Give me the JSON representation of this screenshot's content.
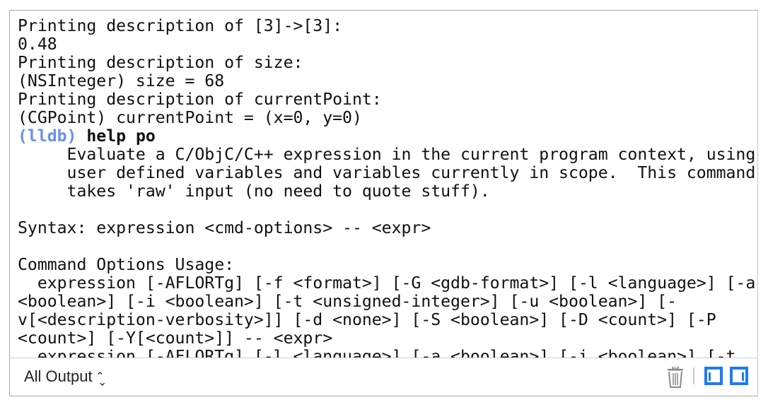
{
  "console": {
    "lines": [
      "Printing description of [3]->[3]:",
      "0.48",
      "Printing description of size:",
      "(NSInteger) size = 68",
      "Printing description of currentPoint:",
      "(CGPoint) currentPoint = (x=0, y=0)",
      "",
      "     Evaluate a C/ObjC/C++ expression in the current program context, using",
      "     user defined variables and variables currently in scope.  This command",
      "     takes 'raw' input (no need to quote stuff).",
      "",
      "Syntax: expression <cmd-options> -- <expr>",
      "",
      "Command Options Usage:",
      "  expression [-AFLORTg] [-f <format>] [-G <gdb-format>] [-l <language>] [-a",
      "<boolean>] [-i <boolean>] [-t <unsigned-integer>] [-u <boolean>] [-",
      "v[<description-verbosity>]] [-d <none>] [-S <boolean>] [-D <count>] [-P",
      "<count>] [-Y[<count>]] -- <expr>",
      "  expression [-AFLORTg] [-l <language>] [-a <boolean>] [-i <boolean>] [-t"
    ],
    "prompt": "(lldb)",
    "command": "help po"
  },
  "footer": {
    "filter_label": "All Output",
    "filter_icon": "up-down-chevron-icon",
    "trash_icon": "trash-icon",
    "left_pane_icon": "left-pane-toggle-icon",
    "right_pane_icon": "right-pane-toggle-icon",
    "accent_color": "#1b7cf0"
  }
}
